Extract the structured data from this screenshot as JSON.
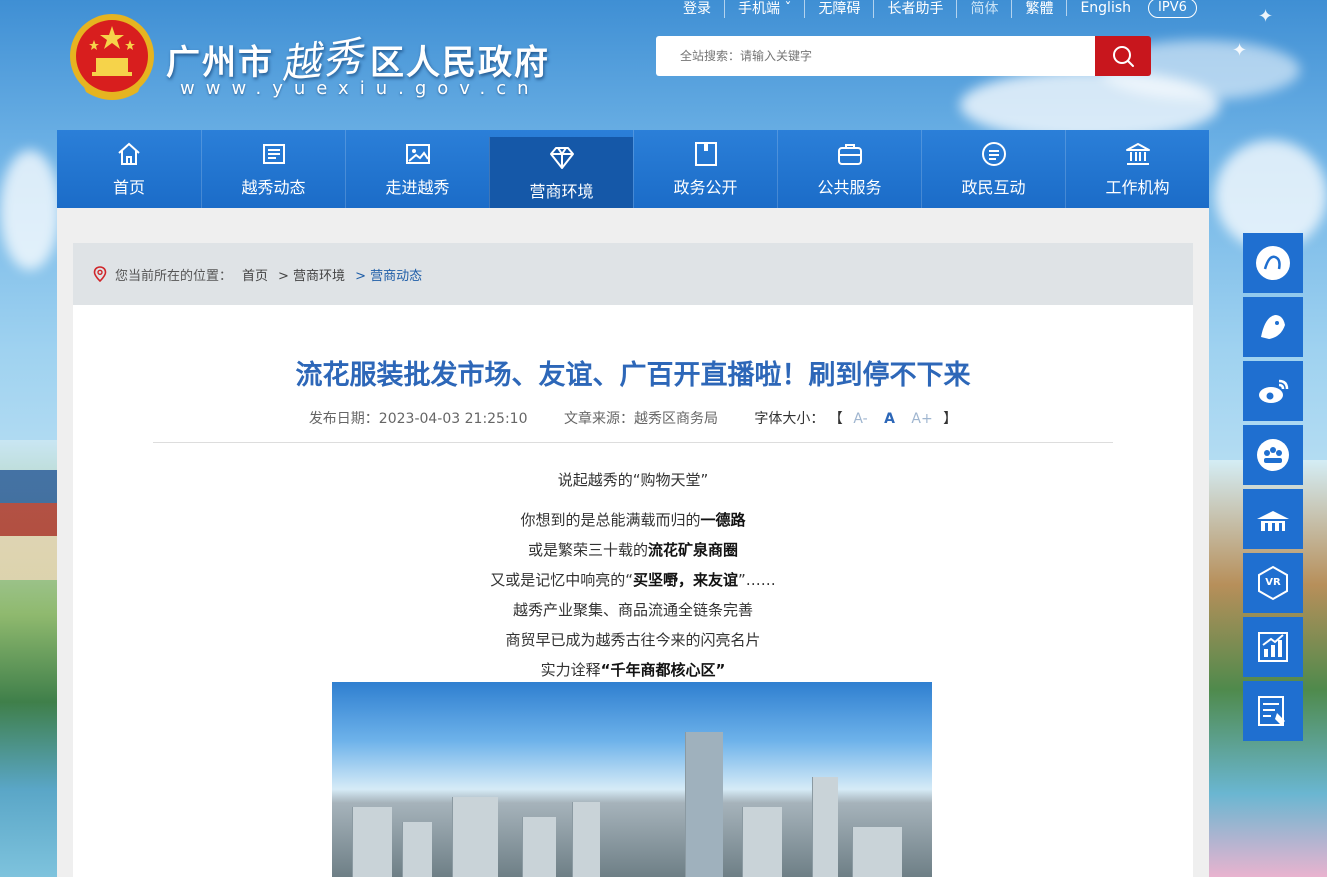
{
  "header": {
    "title_left": "广州市",
    "title_script": "越秀",
    "title_right": "区人民政府",
    "domain": "www.yuexiu.gov.cn"
  },
  "top_links": [
    {
      "label": "登录"
    },
    {
      "label": "手机端 ˇ"
    },
    {
      "label": "无障碍"
    },
    {
      "label": "长者助手"
    },
    {
      "label": "简体"
    },
    {
      "label": "繁體"
    },
    {
      "label": "English"
    }
  ],
  "ipv6": "IPV6",
  "search": {
    "placeholder": "全站搜索：请输入关键字"
  },
  "nav": [
    {
      "label": "首页",
      "icon": "home-icon"
    },
    {
      "label": "越秀动态",
      "icon": "newspaper-icon"
    },
    {
      "label": "走进越秀",
      "icon": "picture-icon"
    },
    {
      "label": "营商环境",
      "icon": "diamond-icon"
    },
    {
      "label": "政务公开",
      "icon": "document-icon"
    },
    {
      "label": "公共服务",
      "icon": "briefcase-icon"
    },
    {
      "label": "政民互动",
      "icon": "chat-icon"
    },
    {
      "label": "工作机构",
      "icon": "institution-icon"
    }
  ],
  "nav_active": "营商环境",
  "breadcrumb": {
    "prefix": "您当前所在的位置：",
    "items": [
      "首页",
      "> 营商环境",
      "> 营商动态"
    ]
  },
  "article": {
    "title": "流花服装批发市场、友谊、广百开直播啦！刷到停不下来",
    "date_label": "发布日期：2023-04-03 21:25:10",
    "source_label": "文章来源：越秀区商务局",
    "font_size_label": "字体大小：",
    "font_sizes": [
      "A-",
      "A",
      "A+"
    ],
    "bracket_open": "【",
    "bracket_close": "】",
    "lines": [
      {
        "pre": "说起越秀的“购物天堂”",
        "bold": "",
        "post": ""
      },
      {
        "pre": "你想到的是总能满载而归的",
        "bold": "一德路",
        "post": ""
      },
      {
        "pre": "或是繁荣三十载的",
        "bold": "流花矿泉商圈",
        "post": ""
      },
      {
        "pre": "又或是记忆中响亮的“",
        "bold": "买坚嘢，来友谊",
        "post": "”……"
      },
      {
        "pre": "越秀产业聚集、商品流通全链条完善",
        "bold": "",
        "post": ""
      },
      {
        "pre": "商贸早已成为越秀古往今来的闪亮名片",
        "bold": "",
        "post": ""
      },
      {
        "pre": "实力诠释",
        "bold": "“千年商都核心区”",
        "post": ""
      }
    ]
  },
  "side_buttons": [
    {
      "icon": "yuexiu-logo-icon"
    },
    {
      "icon": "yuexiu-mascot-icon"
    },
    {
      "icon": "weibo-icon"
    },
    {
      "icon": "service-group-icon"
    },
    {
      "icon": "yuexiu-landmark-icon"
    },
    {
      "icon": "vr-icon"
    },
    {
      "icon": "statistics-chart-icon"
    },
    {
      "icon": "online-form-icon"
    }
  ],
  "colors": {
    "nav_bg": "#1b6cc8",
    "nav_active": "#1558a8",
    "title": "#2d67b8",
    "search_button": "#c8161d",
    "side_button": "#1f6fd0"
  }
}
